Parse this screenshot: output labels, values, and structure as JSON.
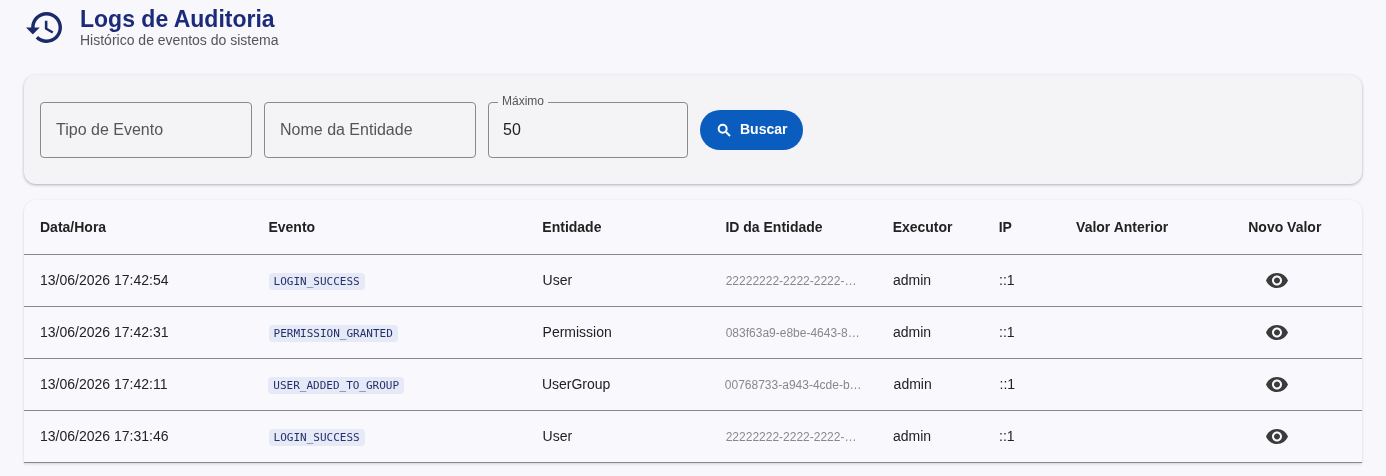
{
  "header": {
    "title": "Logs de Auditoria",
    "subtitle": "Histórico de eventos do sistema"
  },
  "filters": {
    "fields": [
      {
        "placeholder": "Tipo de Evento"
      },
      {
        "placeholder": "Nome da Entidade"
      },
      {
        "label": "Máximo",
        "value": "50"
      }
    ],
    "search_button": "Buscar"
  },
  "table": {
    "columns": [
      "Data/Hora",
      "Evento",
      "Entidade",
      "ID da Entidade",
      "Executor",
      "IP",
      "Valor Anterior",
      "Novo Valor"
    ],
    "rows": [
      {
        "datetime": "13/06/2026 17:42:54",
        "event": "LOGIN_SUCCESS",
        "entity": "User",
        "entity_id": "22222222-2222-2222-…",
        "executor": "admin",
        "ip": "::1"
      },
      {
        "datetime": "13/06/2026 17:42:31",
        "event": "PERMISSION_GRANTED",
        "entity": "Permission",
        "entity_id": "083f63a9-e8be-4643-8…",
        "executor": "admin",
        "ip": "::1"
      },
      {
        "datetime": "13/06/2026 17:42:11",
        "event": "USER_ADDED_TO_GROUP",
        "entity": "UserGroup",
        "entity_id": "00768733-a943-4cde-b…",
        "executor": "admin",
        "ip": "::1"
      },
      {
        "datetime": "13/06/2026 17:31:46",
        "event": "LOGIN_SUCCESS",
        "entity": "User",
        "entity_id": "22222222-2222-2222-…",
        "executor": "admin",
        "ip": "::1"
      }
    ]
  }
}
